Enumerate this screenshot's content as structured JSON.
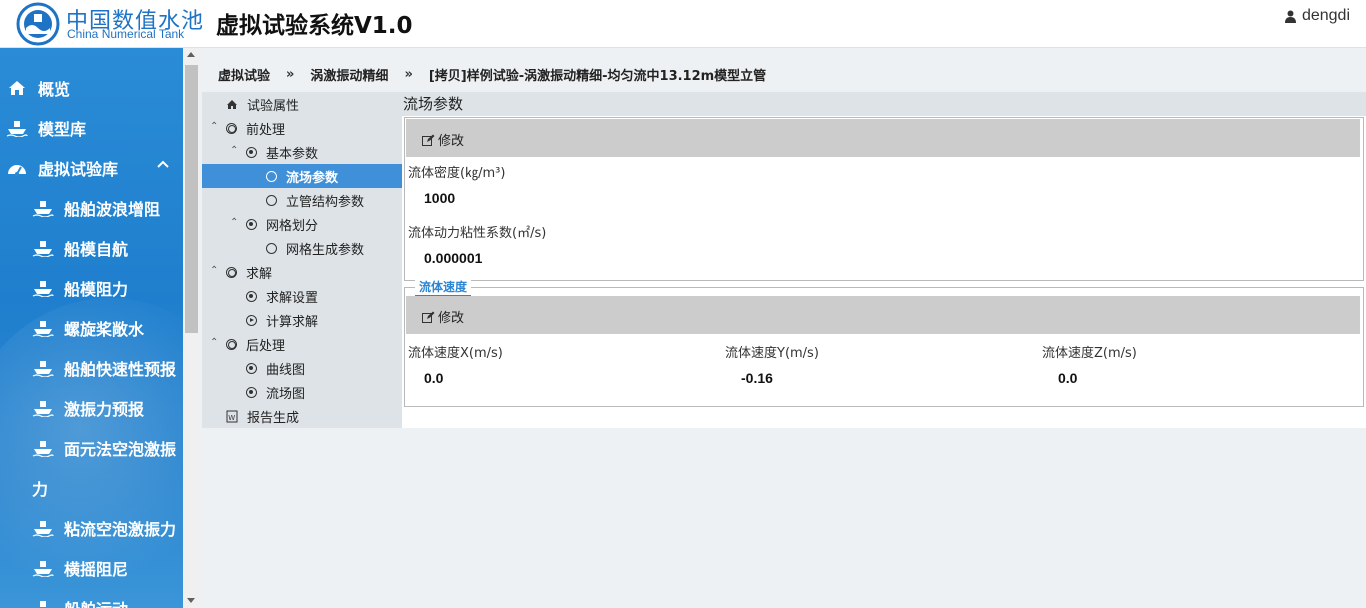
{
  "header": {
    "brand_cn": "中国数值水池",
    "brand_en": "China Numerical Tank",
    "app_title": "虚拟试验系统V1.0",
    "username": "dengdi"
  },
  "sidebar": {
    "items": [
      {
        "label": "概览",
        "icon": "home-icon"
      },
      {
        "label": "模型库",
        "icon": "ship-icon"
      },
      {
        "label": "虚拟试验库",
        "icon": "dashboard-icon"
      },
      {
        "label": "船舶波浪增阻",
        "icon": "ship-icon"
      },
      {
        "label": "船模自航",
        "icon": "ship-icon"
      },
      {
        "label": "船模阻力",
        "icon": "ship-icon"
      },
      {
        "label": "螺旋桨敞水",
        "icon": "ship-icon"
      },
      {
        "label": "船舶快速性预报",
        "icon": "ship-icon"
      },
      {
        "label": "激振力预报",
        "icon": "ship-icon"
      },
      {
        "label": "面元法空泡激振",
        "icon": "ship-icon"
      },
      {
        "label": "力",
        "icon": ""
      },
      {
        "label": "粘流空泡激振力",
        "icon": "ship-icon"
      },
      {
        "label": "横摇阻尼",
        "icon": "ship-icon"
      },
      {
        "label": "船舶运动",
        "icon": "ship-icon"
      }
    ]
  },
  "breadcrumb": [
    "虚拟试验",
    "涡激振动精细",
    "[拷贝]样例试验-涡激振动精细-均匀流中13.12m模型立管"
  ],
  "breadcrumb_sep": "»",
  "tree": {
    "items": [
      {
        "label": "试验属性"
      },
      {
        "label": "前处理"
      },
      {
        "label": "基本参数"
      },
      {
        "label": "流场参数"
      },
      {
        "label": "立管结构参数"
      },
      {
        "label": "网格划分"
      },
      {
        "label": "网格生成参数"
      },
      {
        "label": "求解"
      },
      {
        "label": "求解设置"
      },
      {
        "label": "计算求解"
      },
      {
        "label": "后处理"
      },
      {
        "label": "曲线图"
      },
      {
        "label": "流场图"
      },
      {
        "label": "报告生成"
      }
    ]
  },
  "content": {
    "panel_title": "流场参数",
    "edit_label": "修改",
    "fluid_density_label": "流体密度(㎏/m³)",
    "fluid_density_value": "1000",
    "viscosity_label": "流体动力粘性系数(㎡/s)",
    "viscosity_value": "0.000001",
    "velocity_section": "流体速度",
    "vel_x_label": "流体速度X(m/s)",
    "vel_x_value": "0.0",
    "vel_y_label": "流体速度Y(m/s)",
    "vel_y_value": "-0.16",
    "vel_z_label": "流体速度Z(m/s)",
    "vel_z_value": "0.0"
  },
  "colors": {
    "brand_blue": "#1f73c4",
    "sidebar_blue": "#2a8bd6",
    "selected_blue": "#3f8fd9",
    "edit_bar": "#cccccc"
  }
}
